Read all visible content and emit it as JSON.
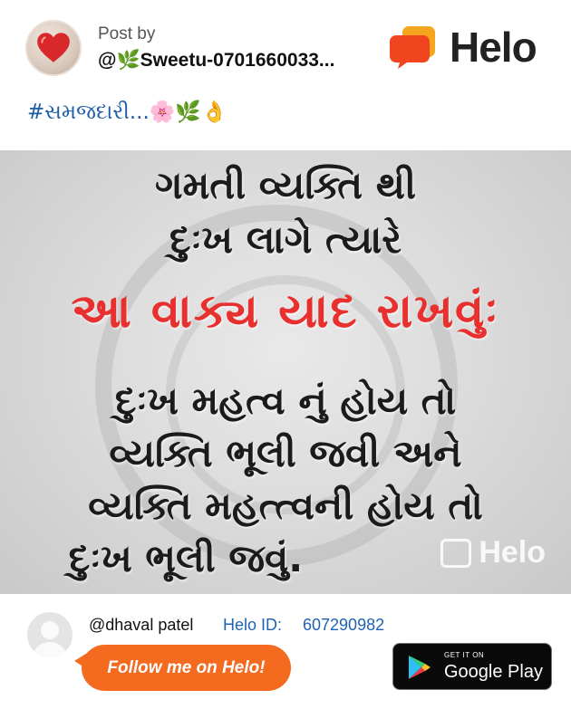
{
  "post": {
    "postby_label": "Post by",
    "author": "@🌿Sweetu-0701660033...",
    "hashtag": "#સમજદારી...🌸🌿👌"
  },
  "brand": {
    "name": "Helo"
  },
  "image": {
    "lines": [
      "ગમતી વ્યક્તિ થી",
      "દુઃખ લાગે ત્યારે",
      "આ વાક્ય યાદ રાખવુંઃ",
      "દુઃખ મહત્વ નું હોય તો",
      "વ્યક્તિ ભૂલી જવી અને",
      "વ્યક્તિ મહત્ત્વની હોય તો",
      "દુઃખ ભૂલી જવું."
    ],
    "watermark": "Helo"
  },
  "footer": {
    "handle": "@dhaval patel",
    "id_label": "Helo ID:",
    "id_value": "607290982",
    "follow_label": "Follow me on Helo!",
    "store_small": "GET IT ON",
    "store_big": "Google Play"
  },
  "colors": {
    "accent_orange": "#f46a1f",
    "link_blue": "#1f63b5",
    "quote_red": "#e8302e"
  }
}
